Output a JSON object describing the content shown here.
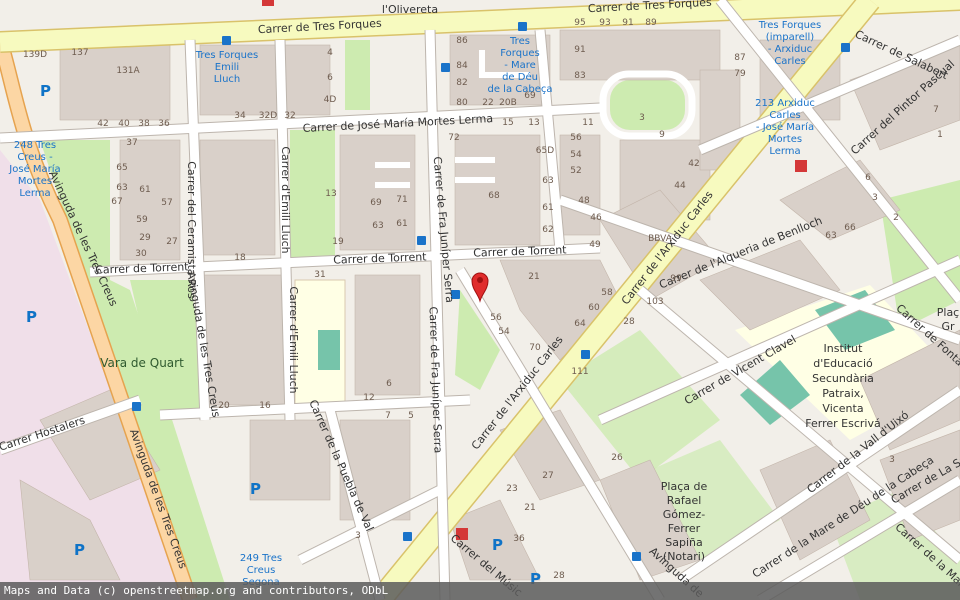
{
  "streets": {
    "tres_forques_top": "Carrer de Tres Forques",
    "tres_forques_left": "Carrer de Tres Forques",
    "jose_maria": "Carrer de José María Mortes Lerma",
    "torrent_left": "Carrer de Torrent",
    "torrent_mid": "Carrer de Torrent",
    "torrent_right": "Carrer de Torrent",
    "ceramista": "Carrer del Ceramista Ros",
    "emili_upper": "Carrer d'Emili Lluch",
    "emili_lower": "Carrer d'Emili Lluch",
    "fra_upper": "Carrer de Fra Juníper Serra",
    "fra_lower": "Carrer de Fra Juníper Serra",
    "tres_creus_main": "Avinguda de les Tres Creus",
    "tres_creus_mid": "Avinguda de les Tres Creus",
    "tres_creus_bottom": "Avinguda de les Tres Creus",
    "arxiduc_upper": "Carrer de l'Arxiduc Carles",
    "arxiduc_lower": "Carrer de l'Arxiduc Carles",
    "alqueria": "Carrer de l'Alqueria de Benlloch",
    "vicent": "Carrer de Vicent Clavel",
    "salabert": "Carrer de Salabert",
    "pintor": "Carrer del Pintor Pascual",
    "fontan": "Carrer de Fontan",
    "hostalers": "Carrer Hostalers",
    "puebla": "Carrer de la Puebla de Val",
    "vall": "Carrer de la Vall d'Uixó",
    "mare_deu": "Carrer de la Mare de Déu de la Cabeça",
    "mare_deu_short": "Carrer de la Mare",
    "la_sal": "Carrer de La Sal",
    "musico": "Carrer del Músic",
    "avinguda_bottom": "Avinguda de",
    "olivereta": "l'Olivereta"
  },
  "places": {
    "vara_de_quart": "Vara de Quart",
    "institut": [
      "Institut",
      "d'Educació",
      "Secundària",
      "Patraix,",
      "Vicenta",
      "Ferrer Escrivá"
    ],
    "placa_rafael": [
      "Plaça de",
      "Rafael",
      "Gómez-",
      "Ferrer",
      "Sapiña",
      "(Notari)"
    ],
    "placa_right": [
      "Plaç",
      "Gr"
    ],
    "bbva": "BBVA"
  },
  "stops": {
    "tres_forques_emili": [
      "Tres Forques",
      "Emili",
      "Lluch"
    ],
    "tres_forques_mare": [
      "Tres",
      "Forques",
      "- Mare",
      "de Déu",
      "de la Cabeça"
    ],
    "tres_forques_imparell": [
      "Tres Forques",
      "(imparell)",
      "- Arxiduc",
      "Carles"
    ],
    "bike_213": [
      "213 Arxiduc",
      "Carles",
      "- José María",
      "Mortes",
      "Lerma"
    ],
    "bike_248": [
      "248 Tres",
      "Creus -",
      "José María",
      "Mortes",
      "Lerma"
    ],
    "bike_249": [
      "249 Tres",
      "Creus",
      "Segona"
    ]
  },
  "numbers": [
    [
      "139D",
      35,
      57
    ],
    [
      "137",
      80,
      55
    ],
    [
      "131A",
      128,
      73
    ],
    [
      "42",
      103,
      126
    ],
    [
      "40",
      124,
      126
    ],
    [
      "38",
      144,
      126
    ],
    [
      "36",
      164,
      126
    ],
    [
      "34",
      240,
      118
    ],
    [
      "32D",
      268,
      118
    ],
    [
      "32",
      290,
      118
    ],
    [
      "4D",
      330,
      102
    ],
    [
      "6",
      330,
      80
    ],
    [
      "4",
      330,
      55
    ],
    [
      "37",
      132,
      145
    ],
    [
      "65",
      122,
      170
    ],
    [
      "63",
      122,
      190
    ],
    [
      "67",
      117,
      204
    ],
    [
      "61",
      145,
      192
    ],
    [
      "57",
      167,
      205
    ],
    [
      "59",
      142,
      222
    ],
    [
      "30",
      141,
      256
    ],
    [
      "29",
      145,
      240
    ],
    [
      "27",
      172,
      244
    ],
    [
      "13",
      331,
      196
    ],
    [
      "19",
      338,
      244
    ],
    [
      "69",
      376,
      205
    ],
    [
      "71",
      402,
      202
    ],
    [
      "63",
      378,
      228
    ],
    [
      "61",
      402,
      226
    ],
    [
      "18",
      240,
      260
    ],
    [
      "31",
      320,
      277
    ],
    [
      "86",
      462,
      43
    ],
    [
      "84",
      462,
      68
    ],
    [
      "82",
      462,
      85
    ],
    [
      "80",
      462,
      105
    ],
    [
      "22",
      488,
      105
    ],
    [
      "20B",
      508,
      105
    ],
    [
      "69",
      530,
      98
    ],
    [
      "95",
      580,
      25
    ],
    [
      "93",
      605,
      25
    ],
    [
      "91",
      628,
      25
    ],
    [
      "89",
      651,
      25
    ],
    [
      "91",
      580,
      52
    ],
    [
      "83",
      580,
      78
    ],
    [
      "87",
      740,
      60
    ],
    [
      "79",
      740,
      76
    ],
    [
      "15",
      508,
      125
    ],
    [
      "13",
      534,
      125
    ],
    [
      "72",
      454,
      140
    ],
    [
      "65D",
      545,
      153
    ],
    [
      "63",
      548,
      183
    ],
    [
      "61",
      548,
      210
    ],
    [
      "62",
      548,
      232
    ],
    [
      "68",
      494,
      198
    ],
    [
      "11",
      588,
      125
    ],
    [
      "56",
      576,
      140
    ],
    [
      "54",
      576,
      157
    ],
    [
      "52",
      576,
      173
    ],
    [
      "48",
      584,
      203
    ],
    [
      "46",
      596,
      220
    ],
    [
      "44",
      680,
      188
    ],
    [
      "42",
      694,
      166
    ],
    [
      "3",
      642,
      120
    ],
    [
      "9",
      662,
      137
    ],
    [
      "49",
      595,
      247
    ],
    [
      "21",
      534,
      279
    ],
    [
      "60",
      594,
      310
    ],
    [
      "58",
      607,
      295
    ],
    [
      "56",
      496,
      320
    ],
    [
      "54",
      504,
      334
    ],
    [
      "70",
      535,
      350
    ],
    [
      "64",
      580,
      326
    ],
    [
      "103",
      655,
      304
    ],
    [
      "99",
      676,
      281
    ],
    [
      "63",
      831,
      238
    ],
    [
      "66",
      850,
      230
    ],
    [
      "2",
      896,
      220
    ],
    [
      "6",
      868,
      180
    ],
    [
      "7",
      936,
      112
    ],
    [
      "1",
      940,
      137
    ],
    [
      "3",
      875,
      200
    ],
    [
      "20",
      224,
      408
    ],
    [
      "16",
      265,
      408
    ],
    [
      "12",
      369,
      400
    ],
    [
      "7",
      388,
      418
    ],
    [
      "5",
      411,
      418
    ],
    [
      "6",
      389,
      386
    ],
    [
      "28",
      629,
      324
    ],
    [
      "27",
      548,
      478
    ],
    [
      "23",
      512,
      491
    ],
    [
      "21",
      530,
      510
    ],
    [
      "36",
      519,
      541
    ],
    [
      "28",
      559,
      578
    ],
    [
      "26",
      617,
      460
    ],
    [
      "3",
      358,
      538
    ],
    [
      "3",
      892,
      462
    ],
    [
      "111",
      580,
      374
    ]
  ],
  "attribution": "Maps and Data (c) openstreetmap.org and contributors, ODbL"
}
